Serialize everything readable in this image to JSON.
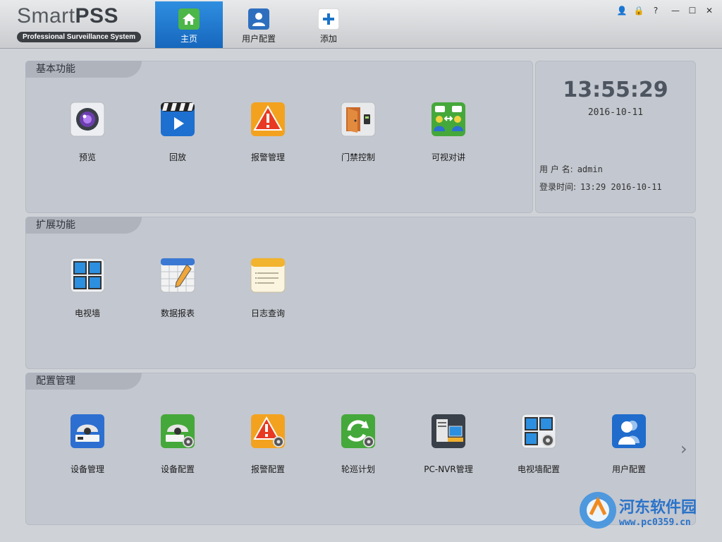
{
  "app": {
    "logo_main": "Smart",
    "logo_main_bold": "PSS",
    "logo_sub": "Professional Surveillance System"
  },
  "tabs": [
    {
      "label": "主页",
      "icon": "home-icon"
    },
    {
      "label": "用户配置",
      "icon": "user-icon"
    },
    {
      "label": "添加",
      "icon": "add-icon"
    }
  ],
  "window_controls": [
    "user-icon",
    "lock-icon",
    "help-icon",
    "minimize-icon",
    "maximize-icon",
    "close-icon"
  ],
  "window_control_glyphs": [
    "👤",
    "🔒",
    "?",
    "—",
    "☐",
    "✕"
  ],
  "basic": {
    "title": "基本功能",
    "items": [
      {
        "label": "预览",
        "icon": "camera-lens-icon"
      },
      {
        "label": "回放",
        "icon": "playback-clapper-icon"
      },
      {
        "label": "报警管理",
        "icon": "alarm-warning-icon"
      },
      {
        "label": "门禁控制",
        "icon": "door-access-icon"
      },
      {
        "label": "可视对讲",
        "icon": "video-intercom-icon"
      }
    ]
  },
  "extend": {
    "title": "扩展功能",
    "items": [
      {
        "label": "电视墙",
        "icon": "tv-wall-icon"
      },
      {
        "label": "数据报表",
        "icon": "data-report-icon"
      },
      {
        "label": "日志查询",
        "icon": "log-query-icon"
      }
    ]
  },
  "config": {
    "title": "配置管理",
    "items": [
      {
        "label": "设备管理",
        "icon": "device-manage-icon"
      },
      {
        "label": "设备配置",
        "icon": "device-config-icon"
      },
      {
        "label": "报警配置",
        "icon": "alarm-config-icon"
      },
      {
        "label": "轮巡计划",
        "icon": "tour-plan-icon"
      },
      {
        "label": "PC-NVR管理",
        "icon": "pc-nvr-icon"
      },
      {
        "label": "电视墙配置",
        "icon": "tv-wall-config-icon"
      },
      {
        "label": "用户配置",
        "icon": "user-config-icon"
      }
    ],
    "next_glyph": "›"
  },
  "status": {
    "time": "13:55:29",
    "date": "2016-10-11",
    "user_label": "用 户 名:",
    "user_value": "admin",
    "login_label": "登录时间:",
    "login_value": "13:29 2016-10-11"
  },
  "watermark": {
    "title": "河东软件园",
    "url": "www.pc0359.cn"
  },
  "colors": {
    "accent": "#1a73c8",
    "panel": "#c3c7cf",
    "panel_tab": "#aeb3bc"
  }
}
